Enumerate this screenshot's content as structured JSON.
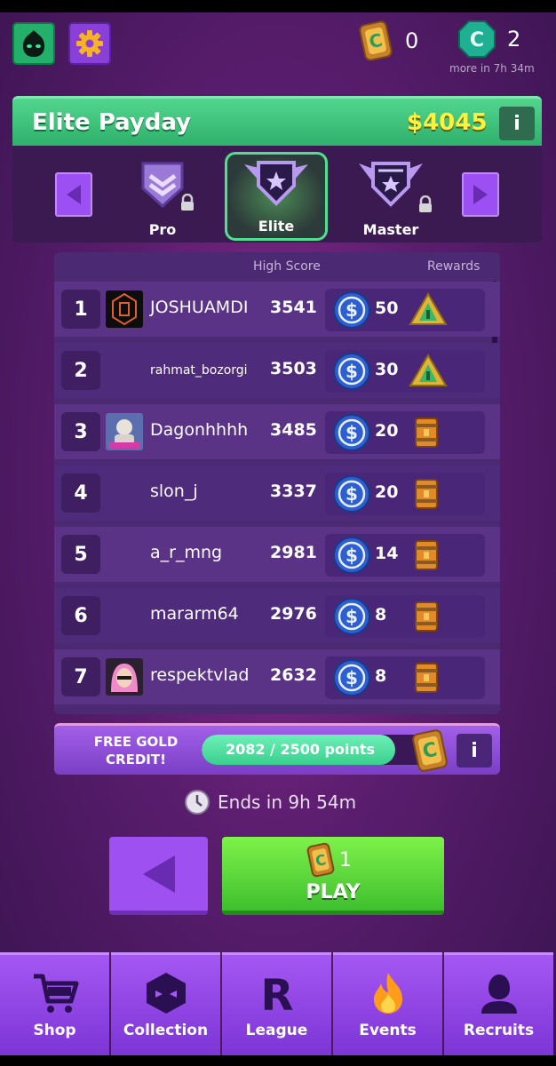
{
  "currency": {
    "gold": "0",
    "green": "2",
    "refill_text": "more in 7h 34m"
  },
  "header": {
    "title": "Elite Payday",
    "amount": "$4045",
    "info_label": "i"
  },
  "tiers": [
    {
      "name": "Pro",
      "locked": true
    },
    {
      "name": "Elite",
      "locked": false,
      "selected": true
    },
    {
      "name": "Master",
      "locked": true
    }
  ],
  "board": {
    "high_score_label": "High Score",
    "rewards_label": "Rewards",
    "rows": [
      {
        "rank": "1",
        "name": "JOSHUAMDI",
        "score": "3541",
        "reward": "50",
        "prize": "pyramid"
      },
      {
        "rank": "2",
        "name": "rahmat_bozorgi",
        "score": "3503",
        "reward": "30",
        "prize": "pyramid"
      },
      {
        "rank": "3",
        "name": "Dagonhhhh",
        "score": "3485",
        "reward": "20",
        "prize": "crate"
      },
      {
        "rank": "4",
        "name": "slon_j",
        "score": "3337",
        "reward": "20",
        "prize": "crate"
      },
      {
        "rank": "5",
        "name": "a_r_mng",
        "score": "2981",
        "reward": "14",
        "prize": "crate"
      },
      {
        "rank": "6",
        "name": "mararm64",
        "score": "2976",
        "reward": "8",
        "prize": "crate"
      },
      {
        "rank": "7",
        "name": "respektvlad",
        "score": "2632",
        "reward": "8",
        "prize": "crate"
      }
    ]
  },
  "gold_credit": {
    "label": "FREE GOLD CREDIT!",
    "progress_text": "2082 / 2500 points",
    "progress": 0.8328,
    "info_label": "i"
  },
  "ends_text": "Ends in 9h 54m",
  "play": {
    "cost": "1",
    "label": "PLAY"
  },
  "nav": [
    {
      "label": "Shop",
      "icon": "cart-icon"
    },
    {
      "label": "Collection",
      "icon": "collection-icon"
    },
    {
      "label": "League",
      "icon": "league-icon"
    },
    {
      "label": "Events",
      "icon": "flame-icon"
    },
    {
      "label": "Recruits",
      "icon": "recruit-icon"
    }
  ]
}
